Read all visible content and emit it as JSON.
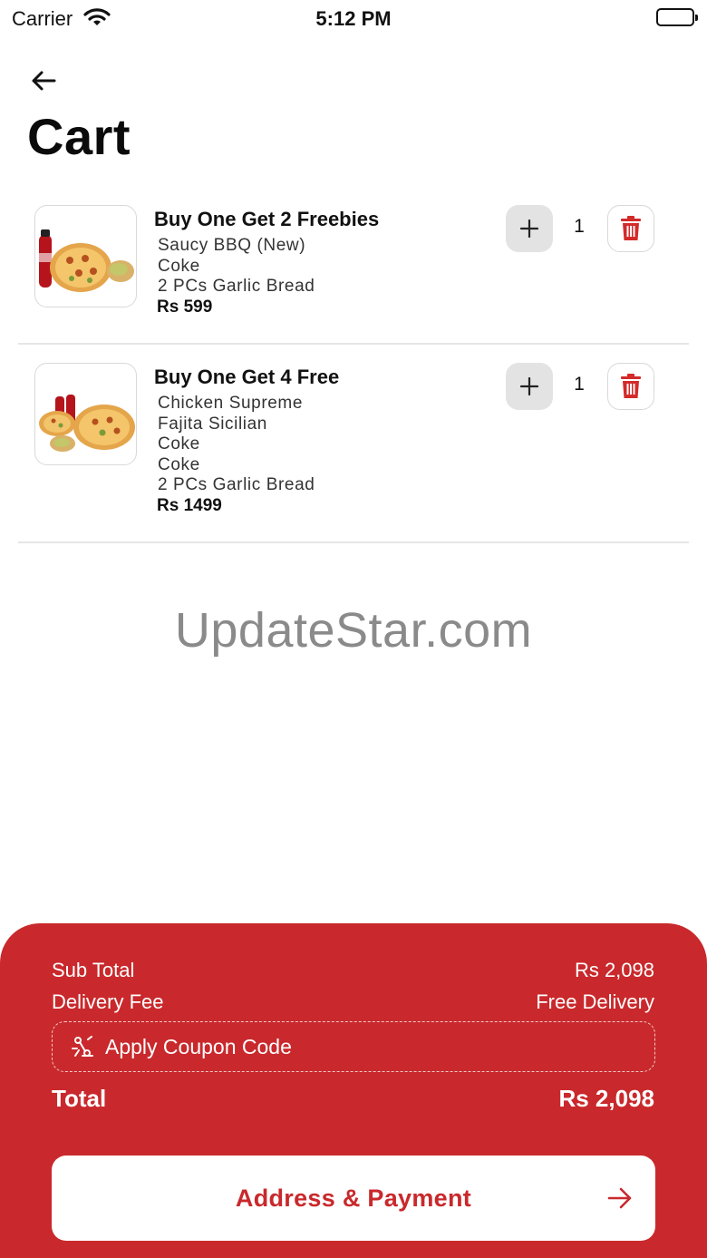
{
  "status_bar": {
    "carrier": "Carrier",
    "time": "5:12 PM"
  },
  "page": {
    "title": "Cart"
  },
  "cart": {
    "items": [
      {
        "name": "Buy One Get 2 Freebies",
        "lines": [
          "Saucy BBQ (New)",
          "Coke",
          "2 PCs Garlic Bread"
        ],
        "price": "Rs 599",
        "quantity": "1"
      },
      {
        "name": "Buy One Get 4 Free",
        "lines": [
          "Chicken Supreme",
          "Fajita Sicilian",
          "Coke",
          "Coke",
          "2 PCs Garlic Bread"
        ],
        "price": "Rs 1499",
        "quantity": "1"
      }
    ]
  },
  "watermark": "UpdateStar.com",
  "summary": {
    "subtotal_label": "Sub Total",
    "subtotal_value": "Rs 2,098",
    "delivery_label": "Delivery Fee",
    "delivery_value": "Free Delivery",
    "coupon_label": "Apply Coupon Code",
    "total_label": "Total",
    "total_value": "Rs 2,098"
  },
  "checkout": {
    "button_label": "Address & Payment"
  },
  "colors": {
    "accent": "#c9292c",
    "button_gray": "#e3e3e3"
  },
  "icons": [
    "wifi-icon",
    "battery-icon",
    "back-arrow-icon",
    "plus-icon",
    "trash-icon",
    "coupon-icon",
    "arrow-right-icon"
  ]
}
